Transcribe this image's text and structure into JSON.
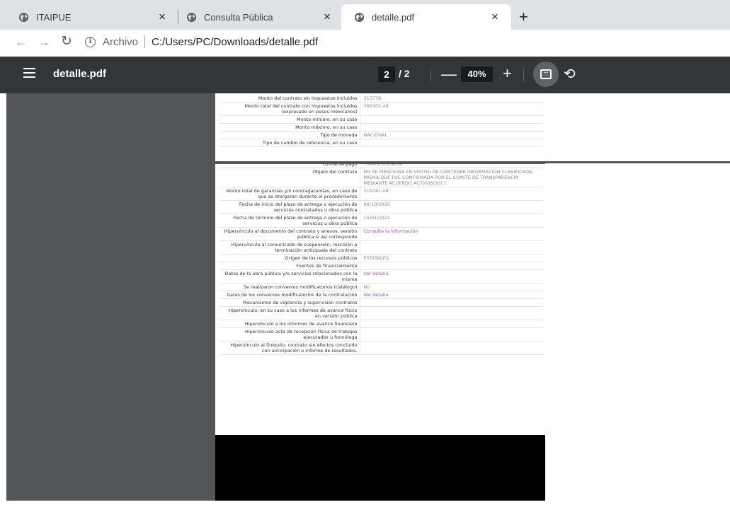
{
  "browser": {
    "tabs": [
      {
        "title": "ITAIPUE",
        "active": false
      },
      {
        "title": "Consulta Pública",
        "active": false
      },
      {
        "title": "detalle.pdf",
        "active": true
      }
    ],
    "tab_close_glyph": "×",
    "new_tab_glyph": "+",
    "address": {
      "scheme_label": "Archivo",
      "url": "C:/Users/PC/Downloads/detalle.pdf"
    }
  },
  "pdf_toolbar": {
    "title": "detalle.pdf",
    "current_page": "2",
    "total_pages": "/ 2",
    "zoom": "40%",
    "zoom_out_glyph": "—",
    "zoom_in_glyph": "+"
  },
  "document": {
    "top_rows": [
      {
        "label": "Monto del contrato sin impuestos incluidos",
        "value": "315778"
      },
      {
        "label": "Monto total del contrato con impuestos incluidos (expresado en pesos mexicanos)",
        "value": "366302.48"
      },
      {
        "label": "Monto mínimo, en su caso",
        "value": ""
      },
      {
        "label": "Monto máximo, en su caso",
        "value": ""
      },
      {
        "label": "Tipo de moneda",
        "value": "NACIONAL"
      },
      {
        "label": "Tipo de cambio de referencia, en su caso",
        "value": ""
      }
    ],
    "main_rows": [
      {
        "label": "Forma de pago",
        "value": "TRANSFERENCIA",
        "link": false
      },
      {
        "label": "Objeto del contrato",
        "value": "NO SE MENCIONA EN VIRTUD DE CONTENER INFORMACIÓN CLASIFICADA, MISMA QUE FUE CONFIRMADA POR EL COMITÉ DE TRANSPARENCIA MEDIANTE ACUERDO ACT/006/2021.",
        "link": false
      },
      {
        "label": "Monto total de garantías y/o contragarantías, en caso de que se otorgaran durante el procedimiento",
        "value": "219781.48",
        "link": false
      },
      {
        "label": "Fecha de inicio del plazo de entrega o ejecución de servicios contratados u obra pública",
        "value": "08/10/2020",
        "link": false
      },
      {
        "label": "Fecha de término del plazo de entrega o ejecución de servicios u obra pública",
        "value": "15/01/2021",
        "link": false
      },
      {
        "label": "Hipervínculo al documento del contrato y anexos, versión pública si así corresponde",
        "value": "Consulta la información",
        "link": true
      },
      {
        "label": "Hipervínculo al comunicado de suspensión, rescisión o terminación anticipada del contrato",
        "value": "",
        "link": false
      },
      {
        "label": "Origen de los recursos públicos",
        "value": "ESTATALES",
        "link": false
      },
      {
        "label": "Fuentes de financiamiento",
        "value": "",
        "link": false
      },
      {
        "label": "Datos de la obra pública y/o servicios relacionados con la misma",
        "value": "Ver detalle",
        "link": true
      },
      {
        "label": "Se realizaron convenios modificatorios (catálogo)",
        "value": "No",
        "link": false
      },
      {
        "label": "Datos de los convenios modificatorios de la contratación",
        "value": "Ver detalle",
        "link": true
      },
      {
        "label": "Mecanismos de vigilancia y supervisión contratos",
        "value": "",
        "link": false
      },
      {
        "label": "Hipervínculo, en su caso a los informes de avance físico en versión pública",
        "value": "",
        "link": false
      },
      {
        "label": "Hipervínculo a los informes de avance financiero",
        "value": "",
        "link": false
      },
      {
        "label": "Hipervínculo acta de recepción física de trabajos ejecutados u homóloga",
        "value": "",
        "link": false
      },
      {
        "label": "Hipervínculo al finiquito, contrato sin efectos concluido con anticipación o informe de resultados,",
        "value": "",
        "link": false
      }
    ]
  },
  "colors": {
    "tabstrip": "#dee1e6",
    "pdf_toolbar": "#323639",
    "viewer_gray": "#525659",
    "link": "#9b4fb8"
  },
  "icons": [
    "globe-icon",
    "close-icon",
    "plus-icon",
    "back-arrow-icon",
    "forward-arrow-icon",
    "reload-icon",
    "info-icon",
    "menu-icon",
    "fit-to-page-icon",
    "rotate-icon"
  ]
}
